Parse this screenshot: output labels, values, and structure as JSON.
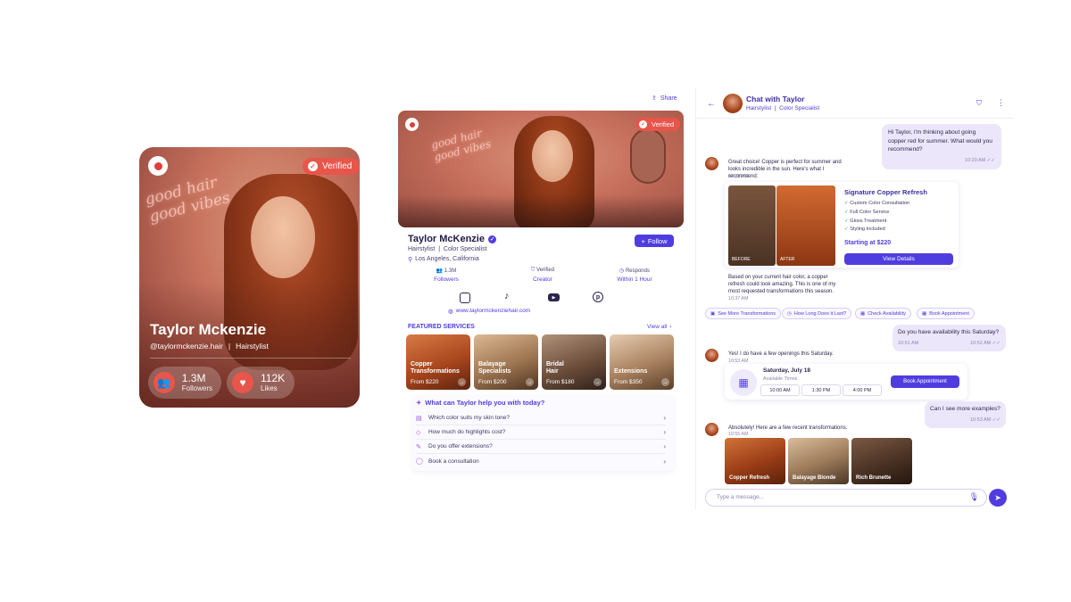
{
  "card1": {
    "neon": [
      "good hair",
      "good vibes"
    ],
    "verified": "Verified",
    "name": "Taylor Mckenzie",
    "handle": "@taylormckenzie.hair",
    "separator": "|",
    "role": "Hairstylist",
    "stats": [
      {
        "value": "1.3M",
        "label": "Followers",
        "icon": "people-icon"
      },
      {
        "value": "112K",
        "label": "Likes",
        "icon": "heart-icon"
      }
    ]
  },
  "profile": {
    "share": "Share",
    "neon": [
      "good hair",
      "good vibes"
    ],
    "verified": "Verified",
    "name": "Taylor McKenzie",
    "subtitle": "Hairstylist  |  Color Specialist",
    "location": "Los Angeles, California",
    "follow": "Follow",
    "stats": [
      {
        "value": "1.3M",
        "label": "Followers"
      },
      {
        "value": "Verified",
        "label": "Creator"
      },
      {
        "value": "Responds",
        "label": "Within 1 Hour"
      }
    ],
    "socials": [
      "instagram-icon",
      "tiktok-icon",
      "youtube-icon",
      "pinterest-icon"
    ],
    "website": "www.taylormckenziehair.com",
    "featured_title": "FEATURED SERVICES",
    "view_all": "View all",
    "services": [
      {
        "name": "Copper Transformations",
        "price": "From $220",
        "colors": [
          "#c96a36",
          "#8f3a14"
        ]
      },
      {
        "name": "Balayage Specialists",
        "price": "From $200",
        "colors": [
          "#c9a27a",
          "#6e4a2e"
        ]
      },
      {
        "name": "Bridal Hair",
        "price": "From $180",
        "colors": [
          "#8a6a55",
          "#3a2a22"
        ]
      },
      {
        "name": "Extensions",
        "price": "From $350",
        "colors": [
          "#d8b898",
          "#7c5a3e"
        ]
      }
    ],
    "help_title": "What can Taylor help you with today?",
    "help_items": [
      {
        "text": "Which color suits my skin tone?",
        "icon": "palette-icon"
      },
      {
        "text": "How much do highlights cost?",
        "icon": "tag-icon"
      },
      {
        "text": "Do you offer extensions?",
        "icon": "pencil-icon"
      },
      {
        "text": "Book a consultation",
        "icon": "chat-icon"
      }
    ]
  },
  "chat": {
    "title": "Chat with Taylor",
    "subtitle": "Hairstylist  |  Color Specialist",
    "msg1": {
      "text": "Hi Taylor, I'm thinking about going copper red for summer. What would you recommend?",
      "time": "10:20 AM"
    },
    "msg2": {
      "text": "Great choice! Copper is perfect for summer and looks incredible in the sun. Here's what I recommend:",
      "time": "10:21 AM"
    },
    "offer": {
      "title": "Signature Copper Refresh",
      "features": [
        "Custom Color Consultation",
        "Full Color Service",
        "Gloss Treatment",
        "Styling Included"
      ],
      "price": "Starting at $220",
      "button": "View Details",
      "before": "BEFORE",
      "after": "AFTER"
    },
    "msg3": {
      "text": "Based on your current hair color, a copper refresh could look amazing. This is one of my most requested transformations this season.",
      "time": "10:37 AM"
    },
    "chips": [
      "See More Transformations",
      "How Long Does it Last?",
      "Check Availability",
      "Book Appointment"
    ],
    "msg4": {
      "text": "Do you have availability this Saturday?",
      "time_left": "10:51 AM",
      "time": "10:52 AM"
    },
    "msg5": {
      "text": "Yes! I do have a few openings this Saturday.",
      "time": "10:53 AM"
    },
    "booking": {
      "date": "Saturday, July 18",
      "subtitle": "Available Times",
      "slots": [
        "10:00 AM",
        "1:30 PM",
        "4:00 PM"
      ],
      "button": "Book Appointment"
    },
    "msg6": {
      "text": "Can I see more examples?",
      "time": "10:53 AM"
    },
    "msg7": {
      "text": "Absolutely! Here are a few recent transformations.",
      "time": "10:55 AM"
    },
    "gallery": [
      {
        "label": "Copper Refresh",
        "colors": [
          "#c4622e",
          "#6e2a10"
        ]
      },
      {
        "label": "Balayage Blonde",
        "colors": [
          "#c9a888",
          "#5a4030"
        ]
      },
      {
        "label": "Rich Brunette",
        "colors": [
          "#6a4a36",
          "#2a1a12"
        ]
      }
    ],
    "input_placeholder": "Type a message..."
  },
  "colors": {
    "accent": "#4f3de0",
    "coral": "#e8554a",
    "bubble": "#ece6fb"
  }
}
